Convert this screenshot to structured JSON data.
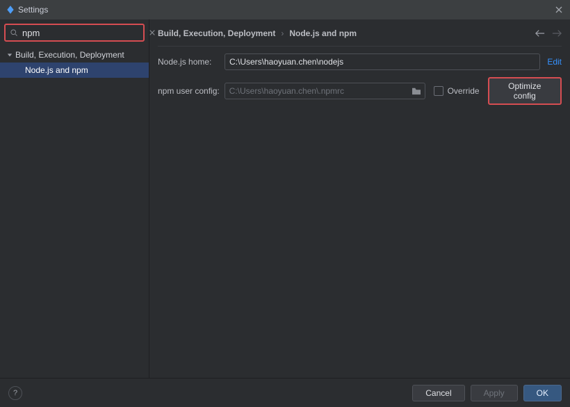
{
  "window": {
    "title": "Settings"
  },
  "search": {
    "value": "npm"
  },
  "sidebar": {
    "group": "Build, Execution, Deployment",
    "child": "Node.js and npm"
  },
  "breadcrumb": {
    "group": "Build, Execution, Deployment",
    "page": "Node.js and npm"
  },
  "form": {
    "nodejs_home_label": "Node.js home:",
    "nodejs_home_value": "C:\\Users\\haoyuan.chen\\nodejs",
    "edit_label": "Edit",
    "npm_config_label": "npm user config:",
    "npm_config_placeholder": "C:\\Users\\haoyuan.chen\\.npmrc",
    "override_label": "Override",
    "optimize_label": "Optimize config"
  },
  "footer": {
    "cancel": "Cancel",
    "apply": "Apply",
    "ok": "OK"
  }
}
